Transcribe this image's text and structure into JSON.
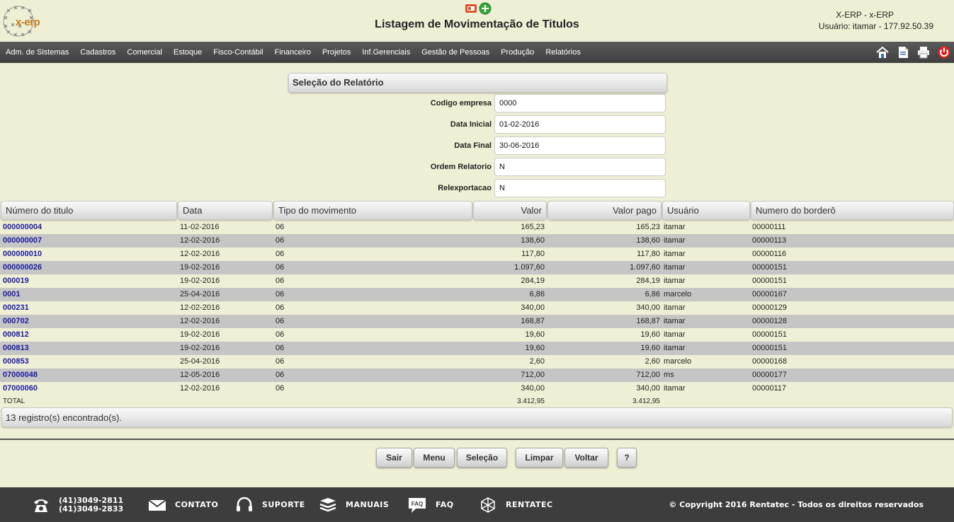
{
  "header": {
    "title": "Listagem de Movimentação de Titulos",
    "system_name": "X-ERP - x-ERP",
    "user_info": "Usuário: itamar - 177.92.50.39",
    "logo_text": "x-erp"
  },
  "menu": {
    "items": [
      "Adm. de Sistemas",
      "Cadastros",
      "Comercial",
      "Estoque",
      "Fisco-Contábil",
      "Financeiro",
      "Projetos",
      "Inf.Gerenciais",
      "Gestão de Pessoas",
      "Produção",
      "Relatórios"
    ]
  },
  "selection": {
    "title": "Seleção do Relatório",
    "fields": [
      {
        "label": "Codigo empresa",
        "value": "0000"
      },
      {
        "label": "Data Inicial",
        "value": "01-02-2016"
      },
      {
        "label": "Data Final",
        "value": "30-06-2016"
      },
      {
        "label": "Ordem Relatorio",
        "value": "N"
      },
      {
        "label": "Relexportacao",
        "value": "N"
      }
    ]
  },
  "table": {
    "columns": [
      "Número do titulo",
      "Data",
      "Tipo do movimento",
      "Valor",
      "Valor pago",
      "Usuário",
      "Numero do borderô"
    ],
    "rows": [
      [
        "000000004",
        "11-02-2016",
        "06",
        "165,23",
        "165,23",
        "itamar",
        "00000111"
      ],
      [
        "000000007",
        "12-02-2016",
        "06",
        "138,60",
        "138,60",
        "itamar",
        "00000113"
      ],
      [
        "000000010",
        "12-02-2016",
        "06",
        "117,80",
        "117,80",
        "itamar",
        "00000116"
      ],
      [
        "000000026",
        "19-02-2016",
        "06",
        "1.097,60",
        "1.097,60",
        "itamar",
        "00000151"
      ],
      [
        "000019",
        "19-02-2016",
        "06",
        "284,19",
        "284,19",
        "itamar",
        "00000151"
      ],
      [
        "0001",
        "25-04-2016",
        "06",
        "6,86",
        "6,86",
        "marcelo",
        "00000167"
      ],
      [
        "000231",
        "12-02-2016",
        "06",
        "340,00",
        "340,00",
        "itamar",
        "00000129"
      ],
      [
        "000702",
        "12-02-2016",
        "06",
        "168,87",
        "168,87",
        "itamar",
        "00000128"
      ],
      [
        "000812",
        "19-02-2016",
        "06",
        "19,60",
        "19,60",
        "itamar",
        "00000151"
      ],
      [
        "000813",
        "19-02-2016",
        "06",
        "19,60",
        "19,60",
        "itamar",
        "00000151"
      ],
      [
        "000853",
        "25-04-2016",
        "06",
        "2,60",
        "2,60",
        "marcelo",
        "00000168"
      ],
      [
        "07000048",
        "12-05-2016",
        "06",
        "712,00",
        "712,00",
        "ms",
        "00000177"
      ],
      [
        "07000060",
        "12-02-2016",
        "06",
        "340,00",
        "340,00",
        "itamar",
        "00000117"
      ]
    ],
    "total_label": "TOTAL",
    "total_valor": "3.412,95",
    "total_valor_pago": "3.412,95",
    "record_count": "13 registro(s) encontrado(s)."
  },
  "buttons": {
    "sair": "Sair",
    "menu": "Menu",
    "selecao": "Seleção",
    "limpar": "Limpar",
    "voltar": "Voltar",
    "help": "?"
  },
  "footer": {
    "phone1": "(41)3049-2811",
    "phone2": "(41)3049-2833",
    "contato": "CONTATO",
    "suporte": "SUPORTE",
    "manuais": "MANUAIS",
    "faq": "FAQ",
    "rentatec": "RENTATEC",
    "copyright": "© Copyright 2016 Rentatec - Todos os direitos reservados"
  },
  "icons": {
    "header": [
      "pdf-icon",
      "add-icon"
    ],
    "menubar": [
      "home-icon",
      "document-icon",
      "print-icon",
      "power-icon"
    ],
    "footer": [
      "phone-icon",
      "mail-icon",
      "headset-icon",
      "books-icon",
      "faq-icon",
      "network-icon"
    ]
  },
  "colors": {
    "background": "#efefd5",
    "menubar": "#4a4a4a",
    "link": "#1a1aa0",
    "alt_row": "#c5c5c5",
    "footer": "#3d3d3d"
  }
}
